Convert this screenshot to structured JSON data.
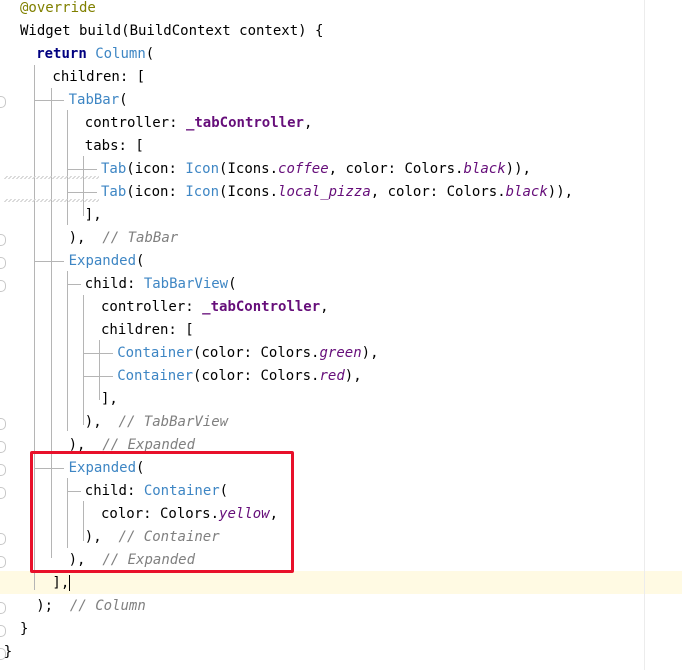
{
  "editor": {
    "accent_highlight_color": "#e8102a",
    "caret_line_color": "#fffae3",
    "lines": [
      {
        "indent": 0,
        "tokens": [
          {
            "t": "@override",
            "c": "ann"
          }
        ]
      },
      {
        "indent": 0,
        "tokens": [
          {
            "t": "Widget build(BuildContext context) {",
            "c": ""
          }
        ]
      },
      {
        "indent": 1,
        "tokens": [
          {
            "t": "return ",
            "c": "kw"
          },
          {
            "t": "Column",
            "c": "cls"
          },
          {
            "t": "(",
            "c": ""
          }
        ]
      },
      {
        "indent": 2,
        "tokens": [
          {
            "t": "children: [",
            "c": ""
          }
        ]
      },
      {
        "indent": 3,
        "tokens": [
          {
            "t": "TabBar",
            "c": "cls"
          },
          {
            "t": "(",
            "c": ""
          }
        ]
      },
      {
        "indent": 4,
        "tokens": [
          {
            "t": "controller: ",
            "c": ""
          },
          {
            "t": "_tabController",
            "c": "fld"
          },
          {
            "t": ",",
            "c": ""
          }
        ]
      },
      {
        "indent": 4,
        "tokens": [
          {
            "t": "tabs: [",
            "c": ""
          }
        ]
      },
      {
        "indent": 5,
        "tokens": [
          {
            "t": "Tab",
            "c": "cls"
          },
          {
            "t": "(icon: ",
            "c": ""
          },
          {
            "t": "Icon",
            "c": "cls"
          },
          {
            "t": "(Icons.",
            "c": ""
          },
          {
            "t": "coffee",
            "c": "it"
          },
          {
            "t": ", color: Colors.",
            "c": ""
          },
          {
            "t": "black",
            "c": "it"
          },
          {
            "t": ")),",
            "c": ""
          }
        ]
      },
      {
        "indent": 5,
        "tokens": [
          {
            "t": "Tab",
            "c": "cls"
          },
          {
            "t": "(icon: ",
            "c": ""
          },
          {
            "t": "Icon",
            "c": "cls"
          },
          {
            "t": "(Icons.",
            "c": ""
          },
          {
            "t": "local_pizza",
            "c": "it"
          },
          {
            "t": ", color: Colors.",
            "c": ""
          },
          {
            "t": "black",
            "c": "it"
          },
          {
            "t": ")),",
            "c": ""
          }
        ]
      },
      {
        "indent": 4,
        "tokens": [
          {
            "t": "],",
            "c": ""
          }
        ]
      },
      {
        "indent": 3,
        "tokens": [
          {
            "t": "),  ",
            "c": ""
          },
          {
            "t": "// TabBar",
            "c": "cmt"
          }
        ]
      },
      {
        "indent": 3,
        "tokens": [
          {
            "t": "Expanded",
            "c": "cls"
          },
          {
            "t": "(",
            "c": ""
          }
        ]
      },
      {
        "indent": 4,
        "tokens": [
          {
            "t": "child: ",
            "c": ""
          },
          {
            "t": "TabBarView",
            "c": "cls"
          },
          {
            "t": "(",
            "c": ""
          }
        ]
      },
      {
        "indent": 5,
        "tokens": [
          {
            "t": "controller: ",
            "c": ""
          },
          {
            "t": "_tabController",
            "c": "fld"
          },
          {
            "t": ",",
            "c": ""
          }
        ]
      },
      {
        "indent": 5,
        "tokens": [
          {
            "t": "children: [",
            "c": ""
          }
        ]
      },
      {
        "indent": 6,
        "tokens": [
          {
            "t": "Container",
            "c": "cls"
          },
          {
            "t": "(color: Colors.",
            "c": ""
          },
          {
            "t": "green",
            "c": "it"
          },
          {
            "t": "),",
            "c": ""
          }
        ]
      },
      {
        "indent": 6,
        "tokens": [
          {
            "t": "Container",
            "c": "cls"
          },
          {
            "t": "(color: Colors.",
            "c": ""
          },
          {
            "t": "red",
            "c": "it"
          },
          {
            "t": "),",
            "c": ""
          }
        ]
      },
      {
        "indent": 5,
        "tokens": [
          {
            "t": "],",
            "c": ""
          }
        ]
      },
      {
        "indent": 4,
        "tokens": [
          {
            "t": "),  ",
            "c": ""
          },
          {
            "t": "// TabBarView",
            "c": "cmt"
          }
        ]
      },
      {
        "indent": 3,
        "tokens": [
          {
            "t": "),  ",
            "c": ""
          },
          {
            "t": "// Expanded",
            "c": "cmt"
          }
        ]
      },
      {
        "indent": 3,
        "tokens": [
          {
            "t": "Expanded",
            "c": "cls"
          },
          {
            "t": "(",
            "c": ""
          }
        ]
      },
      {
        "indent": 4,
        "tokens": [
          {
            "t": "child: ",
            "c": ""
          },
          {
            "t": "Container",
            "c": "cls"
          },
          {
            "t": "(",
            "c": ""
          }
        ]
      },
      {
        "indent": 5,
        "tokens": [
          {
            "t": "color: Colors.",
            "c": ""
          },
          {
            "t": "yellow",
            "c": "it"
          },
          {
            "t": ",",
            "c": ""
          }
        ]
      },
      {
        "indent": 4,
        "tokens": [
          {
            "t": "),  ",
            "c": ""
          },
          {
            "t": "// Container",
            "c": "cmt"
          }
        ]
      },
      {
        "indent": 3,
        "tokens": [
          {
            "t": "),  ",
            "c": ""
          },
          {
            "t": "// Expanded",
            "c": "cmt"
          }
        ]
      },
      {
        "indent": 2,
        "tokens": [
          {
            "t": "],",
            "c": ""
          }
        ],
        "caret": true
      },
      {
        "indent": 1,
        "tokens": [
          {
            "t": ");  ",
            "c": ""
          },
          {
            "t": "// Column",
            "c": "cmt"
          }
        ]
      },
      {
        "indent": 0,
        "tokens": [
          {
            "t": "}",
            "c": ""
          }
        ]
      },
      {
        "indent": -1,
        "tokens": [
          {
            "t": "}",
            "c": ""
          }
        ]
      }
    ]
  }
}
